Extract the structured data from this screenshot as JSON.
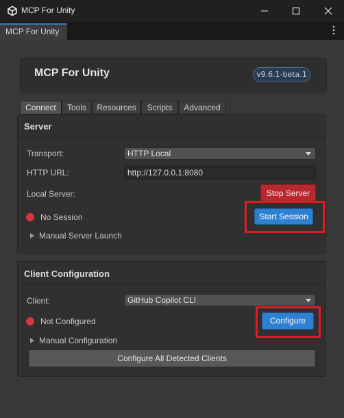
{
  "window": {
    "title": "MCP For Unity",
    "icons": {
      "app": "unity-logo-icon",
      "minimize": "minimize-icon",
      "maximize": "maximize-icon",
      "close": "close-icon"
    }
  },
  "doc_tab": {
    "label": "MCP For Unity"
  },
  "header": {
    "title": "MCP For Unity",
    "version": "v9.6.1-beta.1"
  },
  "tabs": [
    {
      "label": "Connect",
      "active": true
    },
    {
      "label": "Tools"
    },
    {
      "label": "Resources"
    },
    {
      "label": "Scripts"
    },
    {
      "label": "Advanced"
    }
  ],
  "server": {
    "title": "Server",
    "transport_label": "Transport:",
    "transport_value": "HTTP Local",
    "url_label": "HTTP URL:",
    "url_value": "http://127.0.0.1:8080",
    "local_server_label": "Local Server:",
    "stop_button": "Stop Server",
    "status_text": "No Session",
    "status_color": "#d9363e",
    "start_button": "Start Session",
    "manual_launch": "Manual Server Launch"
  },
  "client": {
    "title": "Client Configuration",
    "client_label": "Client:",
    "client_value": "GitHub Copilot CLI",
    "status_text": "Not Configured",
    "status_color": "#d9363e",
    "configure_button": "Configure",
    "manual_config": "Manual Configuration",
    "configure_all_button": "Configure All Detected Clients"
  },
  "colors": {
    "accent_blue": "#2f80d0",
    "danger_red": "#b8282e",
    "highlight": "#e01b24"
  }
}
